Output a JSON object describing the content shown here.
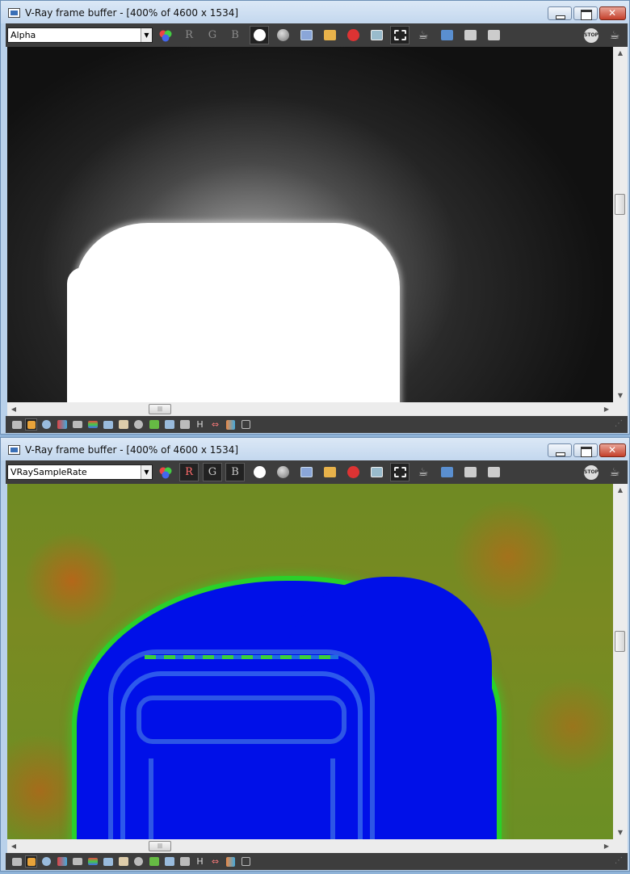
{
  "windows": [
    {
      "title": "V-Ray frame buffer - [400% of 4600 x 1534]",
      "channel": "Alpha",
      "rgb_state": "inactive",
      "render": "alpha"
    },
    {
      "title": "V-Ray frame buffer - [400% of 4600 x 1534]",
      "channel": "VRaySampleRate",
      "rgb_state": "active",
      "render": "samplerate"
    }
  ],
  "toolbar": {
    "r_label": "R",
    "g_label": "G",
    "b_label": "B",
    "stop_label": "STOP"
  },
  "statusbar": {
    "h_label": "H"
  },
  "scroll_arrows": {
    "up": "▲",
    "down": "▼",
    "left": "◀",
    "right": "▶"
  },
  "icons": [
    "app-window-icon",
    "color-balls-icon",
    "circle-white-icon",
    "circle-gray-icon",
    "save-icon",
    "open-folder-icon",
    "clear-icon",
    "region-icon",
    "follow-mouse-icon",
    "teapot-icon",
    "compare-ab-icon",
    "stop-icon",
    "history-icon",
    "info-icon",
    "lut-icon",
    "hsl-icon",
    "levels-icon",
    "curve-icon",
    "exposure-icon",
    "grid-icon",
    "bar-chart-icon"
  ],
  "colors": {
    "titlebar_top": "#dbe8f6",
    "toolbar_bg": "#3d3d3d",
    "close_red": "#c4402b",
    "samplerate_blue": "#0010e8",
    "samplerate_green": "#2ad02a",
    "samplerate_bg": "#7a8a22"
  }
}
